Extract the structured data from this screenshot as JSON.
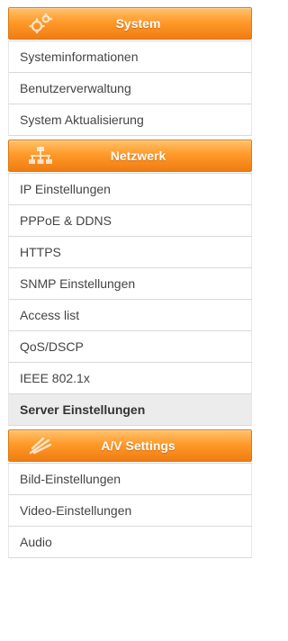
{
  "nav": {
    "sections": [
      {
        "title": "System",
        "icon": "gears-icon",
        "items": [
          "Systeminformationen",
          "Benutzerverwaltung",
          "System Aktualisierung"
        ]
      },
      {
        "title": "Netzwerk",
        "icon": "network-icon",
        "items": [
          "IP Einstellungen",
          "PPPoE & DDNS",
          "HTTPS",
          "SNMP Einstellungen",
          "Access list",
          "QoS/DSCP",
          "IEEE 802.1x",
          "Server Einstellungen"
        ],
        "active_item": "Server Einstellungen"
      },
      {
        "title": "A/V Settings",
        "icon": "av-signal-icon",
        "items": [
          "Bild-Einstellungen",
          "Video-Einstellungen",
          "Audio"
        ]
      }
    ]
  },
  "colors": {
    "header_gradient_top": "#ffc26d",
    "header_gradient_bottom": "#f07c12",
    "header_text": "#ffffff",
    "item_text": "#444444",
    "active_item_bg": "#ececec"
  }
}
